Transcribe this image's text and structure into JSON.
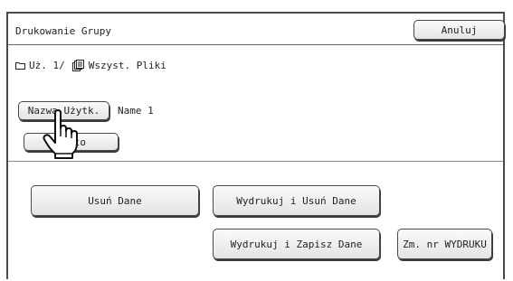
{
  "dialog": {
    "title": "Drukowanie Grupy",
    "cancel_label": "Anuluj"
  },
  "path": {
    "folder_icon": "folder-icon",
    "folder_text": "Uż. 1/",
    "files_icon": "files-icon",
    "files_text": "Wszyst. Pliki"
  },
  "user": {
    "name_button_label": "Nazwa Użytk.",
    "name_value": "Name 1",
    "password_button_label": "Hasło"
  },
  "actions": {
    "delete_label": "Usuń Dane",
    "print_delete_label": "Wydrukuj i Usuń Dane",
    "print_save_label": "Wydrukuj i Zapisz Dane",
    "change_print_no_label": "Zm. nr WYDRUKU"
  },
  "cursor": {
    "icon": "hand-pointer-icon"
  }
}
